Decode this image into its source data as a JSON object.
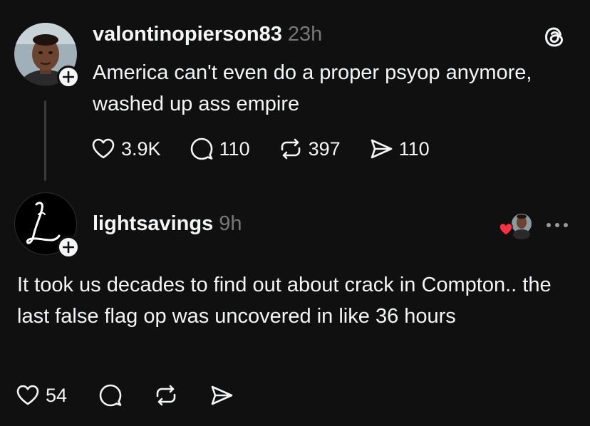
{
  "post1": {
    "username": "valontinopierson83",
    "time": "23h",
    "text": "America can't even do a proper psyop anymore, washed up ass empire",
    "likes": "3.9K",
    "replies": "110",
    "reposts": "397",
    "shares": "110",
    "avatar_icon": "avatar-photo",
    "follow_icon": "plus-icon",
    "app_icon": "threads-logo-icon"
  },
  "post2": {
    "username": "lightsavings",
    "time": "9h",
    "text": "It took us decades to find out about crack in Compton.. the last false flag op was uncovered in like 36 hours",
    "likes": "54",
    "avatar_icon": "avatar-L-logo",
    "follow_icon": "plus-icon",
    "liked_by_icon": "heart-with-avatar-icon",
    "more_icon": "ellipsis-icon"
  },
  "colors": {
    "background": "#101010",
    "primary_text": "#f3f5f7",
    "secondary_text": "#777777",
    "thread_line": "#3a3a3a",
    "like_heart": "#ff3040"
  }
}
